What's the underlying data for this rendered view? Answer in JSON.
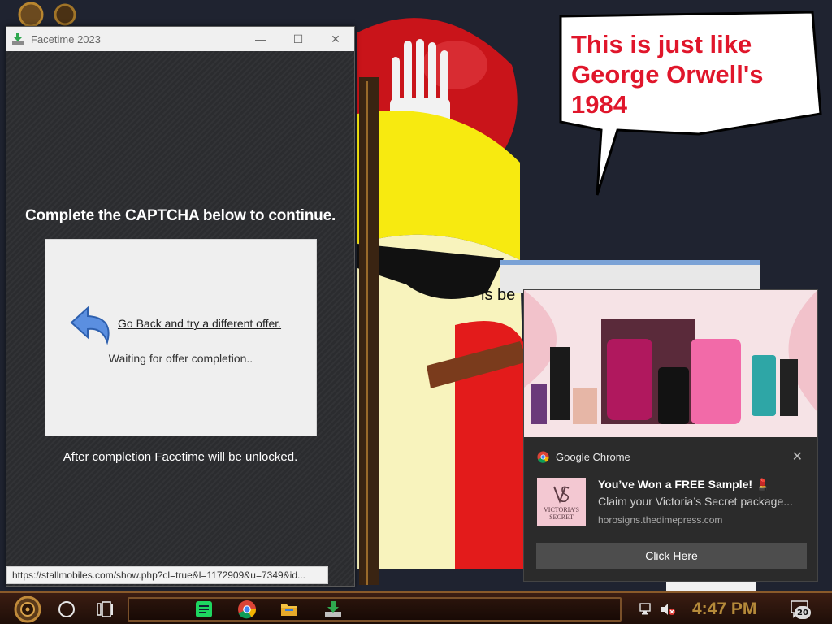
{
  "wallpaper": {
    "speech_bubble_text": "This is just like George Orwell's 1984",
    "partial_text": "is be"
  },
  "facetime_window": {
    "title": "Facetime 2023",
    "controls": {
      "minimize": "—",
      "maximize": "☐",
      "close": "✕"
    },
    "heading": "Complete the CAPTCHA below to continue.",
    "go_back_link": "Go Back and try a different offer.",
    "waiting_text": "Waiting for offer completion..",
    "completion_text": "After completion Facetime will be unlocked.",
    "status_url": "https://stallmobiles.com/show.php?cl=true&l=1172909&u=7349&id..."
  },
  "notification": {
    "app_name": "Google Chrome",
    "close": "✕",
    "title": "You’ve Won a FREE Sample! 💄",
    "message": "Claim your Victoria’s Secret package...",
    "source": "horosigns.thedimepress.com",
    "button_label": "Click Here",
    "logo_text": "VICTORIA'S SECRET"
  },
  "taskbar": {
    "clock": "4:47 PM",
    "notification_count": "20",
    "apps": [
      "spotify-icon",
      "chrome-icon",
      "file-explorer-icon",
      "facetime-installer-icon"
    ]
  }
}
